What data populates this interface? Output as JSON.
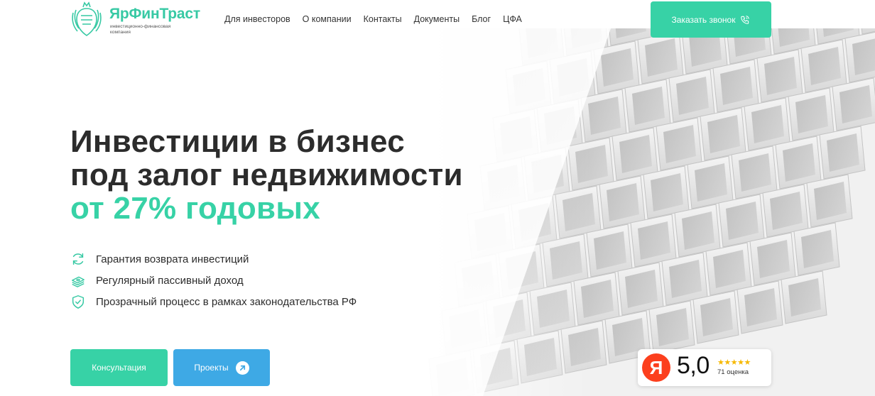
{
  "brand": {
    "name": "ЯрФинТраст",
    "subtitle": "инвестиционно-финансовая компания",
    "color": "#37c9a4"
  },
  "nav": {
    "items": [
      "Для инвесторов",
      "О компании",
      "Контакты",
      "Документы",
      "Блог",
      "ЦФА"
    ]
  },
  "header": {
    "call_button": "Заказать звонок",
    "call_icon": "phone-icon"
  },
  "hero": {
    "title_line1": "Инвестиции в бизнес",
    "title_line2": "под залог недвижимости",
    "title_accent": "от 27% годовых",
    "features": [
      {
        "icon": "refresh-icon",
        "text": "Гарантия возврата инвестиций"
      },
      {
        "icon": "money-stack-icon",
        "text": "Регулярный пассивный доход"
      },
      {
        "icon": "shield-check-icon",
        "text": "Прозрачный процесс в рамках законодательства РФ"
      }
    ],
    "consult_button": "Консультация",
    "projects_button": "Проекты",
    "projects_icon": "arrow-up-right-icon"
  },
  "rating": {
    "logo_letter": "Я",
    "score": "5,0",
    "stars": "★★★★★",
    "count": "71 оценка"
  },
  "colors": {
    "accent": "#37d2a6",
    "blue": "#3ea9e5",
    "yandex": "#fc3f1d",
    "star": "#f6b800"
  }
}
